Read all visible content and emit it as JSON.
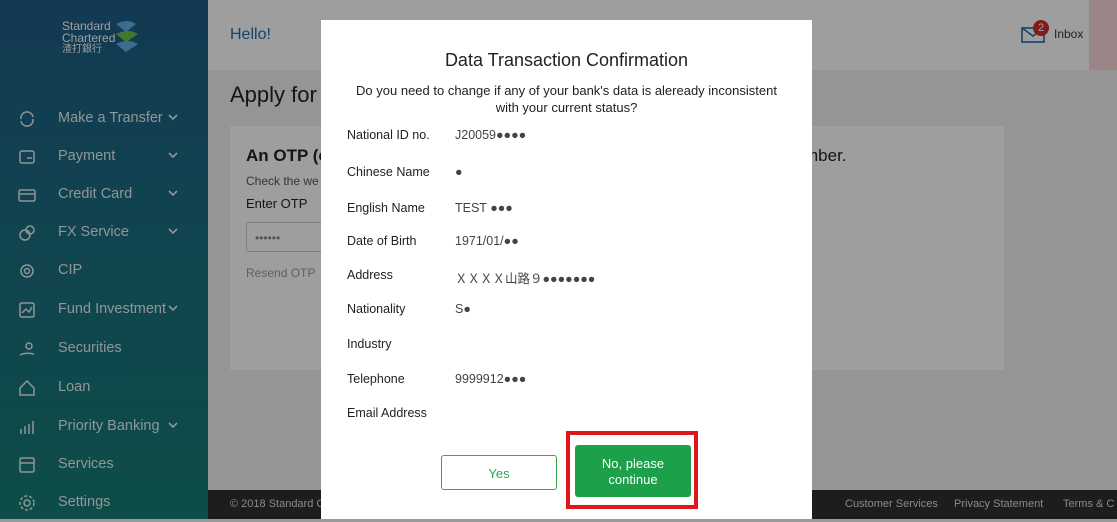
{
  "brand": {
    "line1": "Standard",
    "line2": "Chartered",
    "line3": "渣打銀行"
  },
  "sidebar": {
    "items": [
      {
        "label": "Make a Transfer",
        "icon": "transfer-icon",
        "has_chevron": true
      },
      {
        "label": "Payment",
        "icon": "payment-icon",
        "has_chevron": true
      },
      {
        "label": "Credit Card",
        "icon": "credit-card-icon",
        "has_chevron": true
      },
      {
        "label": "FX Service",
        "icon": "fx-icon",
        "has_chevron": true
      },
      {
        "label": "CIP",
        "icon": "cip-icon",
        "has_chevron": false
      },
      {
        "label": "Fund Investment",
        "icon": "fund-icon",
        "has_chevron": true
      },
      {
        "label": "Securities",
        "icon": "securities-icon",
        "has_chevron": false
      },
      {
        "label": "Loan",
        "icon": "loan-icon",
        "has_chevron": false
      },
      {
        "label": "Priority Banking",
        "icon": "priority-banking-icon",
        "has_chevron": true
      },
      {
        "label": "Services",
        "icon": "services-icon",
        "has_chevron": false
      },
      {
        "label": "Settings",
        "icon": "settings-icon",
        "has_chevron": false
      }
    ]
  },
  "header": {
    "greeting": "Hello!",
    "inbox_label": "Inbox",
    "inbox_count": "2"
  },
  "page": {
    "title": "Apply for",
    "otp_heading": "An OTP (c",
    "otp_heading_end": "mber.",
    "check_text": "Check the we",
    "enter_otp_label": "Enter OTP",
    "otp_value": "••••••",
    "resend_text": "Resend OTP"
  },
  "footer": {
    "copyright": "© 2018 Standard C",
    "customer_services": "Customer Services",
    "privacy": "Privacy Statement",
    "terms": "Terms & C"
  },
  "modal": {
    "title": "Data Transaction Confirmation",
    "subtitle": "Do you need to change if any of your bank's data is aleready inconsistent with your current status?",
    "fields": [
      {
        "label": "National ID no.",
        "value": "J20059●●●●"
      },
      {
        "label": "Chinese Name",
        "value": "●"
      },
      {
        "label": "English Name",
        "value": "TEST ●●●"
      },
      {
        "label": "Date of Birth",
        "value": "1971/01/●●"
      },
      {
        "label": "Address",
        "value": "ＸＸＸＸ山路９●●●●●●●"
      },
      {
        "label": "Nationality",
        "value": "S●"
      },
      {
        "label": "Industry",
        "value": ""
      },
      {
        "label": "Telephone",
        "value": "9999912●●●"
      },
      {
        "label": "Email Address",
        "value": ""
      }
    ],
    "yes_label": "Yes",
    "no_label_line1": "No, please",
    "no_label_line2": "continue"
  },
  "colors": {
    "accent_green": "#1ca04a",
    "highlight_red": "#e0161d",
    "link_blue": "#1b6fb0"
  }
}
